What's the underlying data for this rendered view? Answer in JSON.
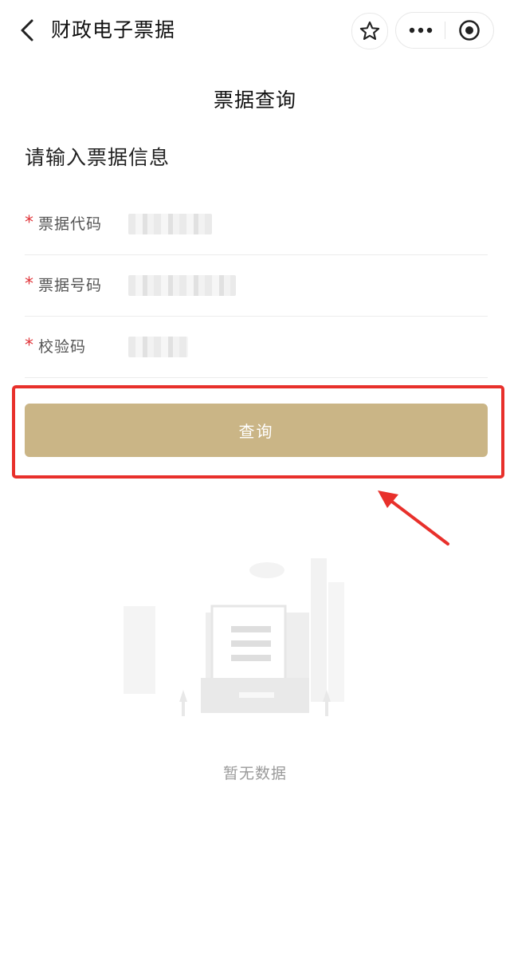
{
  "navbar": {
    "title": "财政电子票据",
    "icons": {
      "back": "chevron-left-icon",
      "favorite": "star-outline-icon",
      "more": "more-dots-icon",
      "close": "miniprogram-close-icon"
    }
  },
  "page": {
    "title": "票据查询",
    "section_title": "请输入票据信息"
  },
  "form": {
    "fields": [
      {
        "required_mark": "*",
        "label": "票据代码",
        "value": ""
      },
      {
        "required_mark": "*",
        "label": "票据号码",
        "value": ""
      },
      {
        "required_mark": "*",
        "label": "校验码",
        "value": ""
      }
    ],
    "submit_label": "查询"
  },
  "empty_state": {
    "text": "暂无数据",
    "icon": "empty-document-illustration"
  },
  "colors": {
    "button_bg": "#cab586",
    "required": "#e0353a",
    "annotation": "#e8302b"
  }
}
